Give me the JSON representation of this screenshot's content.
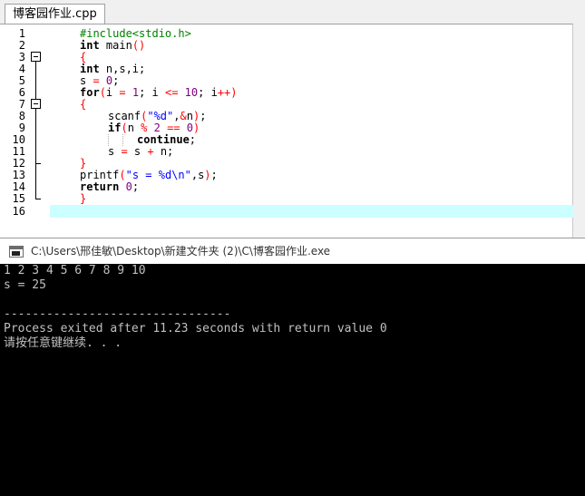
{
  "editor": {
    "tab_label": "博客园作业.cpp",
    "line_numbers": [
      "1",
      "2",
      "3",
      "4",
      "5",
      "6",
      "7",
      "8",
      "9",
      "10",
      "11",
      "12",
      "13",
      "14",
      "15",
      "16"
    ],
    "code": {
      "l1_pp": "#include<stdio.h>",
      "l2_kw": "int",
      "l2_rest": " main",
      "l2_p": "()",
      "l3_br": "{",
      "l4_kw": "int",
      "l4_rest": " n,s,i;",
      "l5_a": "s ",
      "l5_op": "=",
      "l5_sp": " ",
      "l5_num": "0",
      "l5_end": ";",
      "l6_kw": "for",
      "l6_p1": "(",
      "l6_a": "i ",
      "l6_op1": "=",
      "l6_sp1": " ",
      "l6_n1": "1",
      "l6_b": "; i ",
      "l6_op2": "<=",
      "l6_sp2": " ",
      "l6_n2": "10",
      "l6_c": "; i",
      "l6_op3": "++",
      "l6_p2": ")",
      "l7_br": "{",
      "l8_a": "scanf",
      "l8_p1": "(",
      "l8_str": "\"%d\"",
      "l8_b": ",",
      "l8_op": "&",
      "l8_c": "n",
      "l8_p2": ")",
      "l8_end": ";",
      "l9_kw": "if",
      "l9_p1": "(",
      "l9_a": "n ",
      "l9_op1": "%",
      "l9_sp1": " ",
      "l9_n1": "2",
      "l9_sp2": " ",
      "l9_op2": "==",
      "l9_sp3": " ",
      "l9_n2": "0",
      "l9_p2": ")",
      "l10_kw": "continue",
      "l10_end": ";",
      "l11_a": "s ",
      "l11_op1": "=",
      "l11_b": " s ",
      "l11_op2": "+",
      "l11_c": " n;",
      "l12_br": "}",
      "l13_a": "printf",
      "l13_p1": "(",
      "l13_str": "\"s = %d\\n\"",
      "l13_b": ",s",
      "l13_p2": ")",
      "l13_end": ";",
      "l14_kw": "return",
      "l14_sp": " ",
      "l14_num": "0",
      "l14_end": ";",
      "l15_br": "}"
    }
  },
  "console": {
    "title": "C:\\Users\\邢佳敏\\Desktop\\新建文件夹 (2)\\C\\博客园作业.exe",
    "lines": [
      "1 2 3 4 5 6 7 8 9 10",
      "s = 25",
      "",
      "--------------------------------",
      "Process exited after 11.23 seconds with return value 0",
      "请按任意键继续. . ."
    ]
  },
  "colors": {
    "keyword": "#000000",
    "preprocessor": "#008000",
    "string": "#0000ff",
    "number": "#800080",
    "operator": "#ff0000",
    "active_line": "#ccffff",
    "console_bg": "#000000",
    "console_text": "#c0c0c0"
  },
  "icons": {
    "console_window": "console-window-icon",
    "fold_open": "fold-minus-icon"
  }
}
